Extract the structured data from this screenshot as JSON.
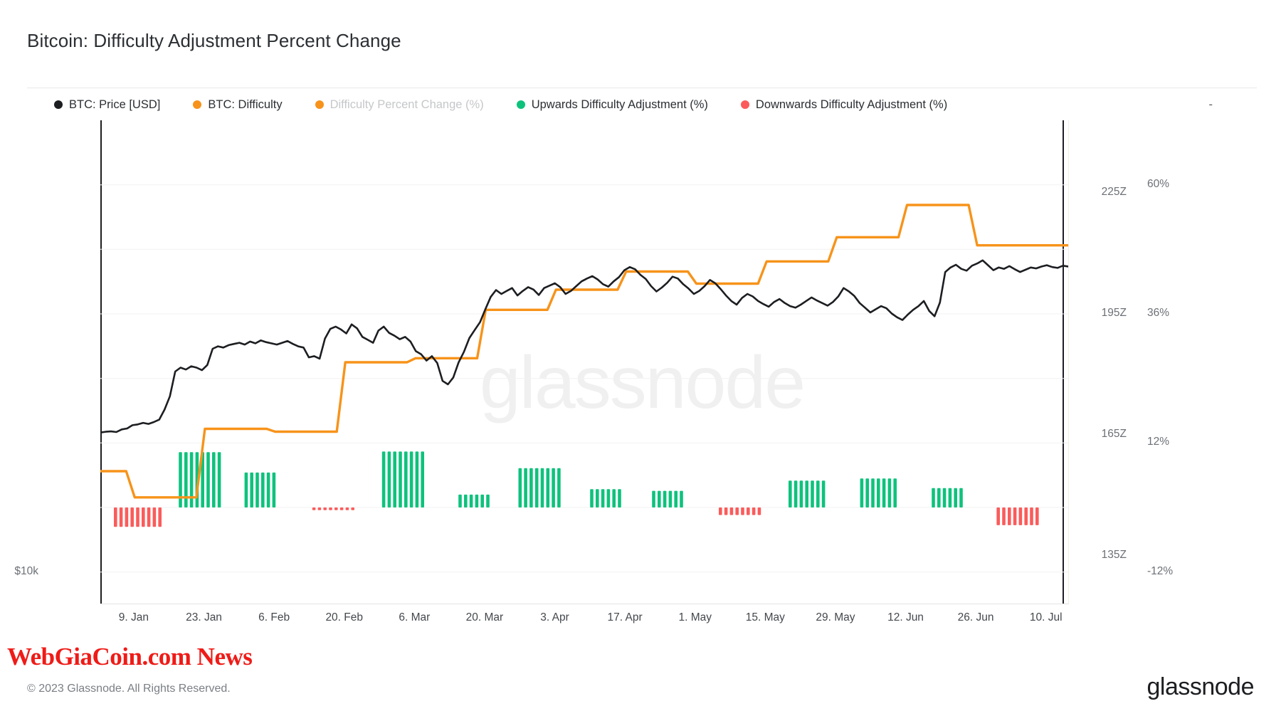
{
  "header": {
    "title": "Bitcoin: Difficulty Adjustment Percent Change"
  },
  "legend": {
    "items": [
      {
        "label": "BTC: Price [USD]",
        "color": "#1c1e21",
        "disabled": false,
        "icon": "legend-dot-icon"
      },
      {
        "label": "BTC: Difficulty",
        "color": "#f7931a",
        "disabled": false,
        "icon": "legend-dot-icon"
      },
      {
        "label": "Difficulty Percent Change (%)",
        "color": "#f7931a",
        "disabled": true,
        "icon": "legend-dot-icon"
      },
      {
        "label": "Upwards Difficulty Adjustment (%)",
        "color": "#0ec27c",
        "disabled": false,
        "icon": "legend-dot-icon"
      },
      {
        "label": "Downwards Difficulty Adjustment (%)",
        "color": "#fb5b5b",
        "disabled": false,
        "icon": "legend-dot-icon"
      }
    ],
    "trailing": "-"
  },
  "footer": {
    "banner": "WebGiaCoin.com News",
    "copyright": "© 2023 Glassnode. All Rights Reserved.",
    "brand": "glassnode",
    "watermark": "glassnode"
  },
  "chart_data": {
    "type": "line",
    "title": "Bitcoin: Difficulty Adjustment Percent Change",
    "xlabel": "",
    "ylabel": "",
    "grid": true,
    "legend_position": "top-left",
    "axes": {
      "left": {
        "name": "BTC: Price [USD]",
        "color": "#1c1e21",
        "scale": "log",
        "ticks": [
          "$10k"
        ],
        "tick_values": [
          10000
        ]
      },
      "right_inner": {
        "name": "BTC: Difficulty",
        "color": "#f7931a",
        "ticks": [
          "225Z",
          "195Z",
          "165Z",
          "135Z"
        ],
        "tick_values": [
          225,
          195,
          165,
          135
        ],
        "unit": "Z"
      },
      "right_outer": {
        "name": "Difficulty Adjustment (%)",
        "ticks": [
          "60%",
          "36%",
          "12%",
          "-12%"
        ],
        "tick_values": [
          60,
          36,
          12,
          -12
        ],
        "unit": "%"
      },
      "x": {
        "ticks": [
          "9. Jan",
          "23. Jan",
          "6. Feb",
          "20. Feb",
          "6. Mar",
          "20. Mar",
          "3. Apr",
          "17. Apr",
          "1. May",
          "15. May",
          "29. May",
          "12. Jun",
          "26. Jun",
          "10. Jul"
        ],
        "range": [
          "2023-01-02",
          "2023-07-14"
        ]
      }
    },
    "series": [
      {
        "name": "BTC: Price [USD]",
        "type": "line",
        "color": "#1c1e21",
        "axis": "left",
        "values": [
          16650,
          16700,
          16720,
          16680,
          16840,
          16900,
          17100,
          17150,
          17250,
          17180,
          17300,
          17450,
          18100,
          19000,
          20800,
          21100,
          20950,
          21200,
          21100,
          20900,
          21300,
          22600,
          22800,
          22700,
          22900,
          23000,
          23100,
          22950,
          23200,
          23050,
          23300,
          23150,
          23050,
          22950,
          23100,
          23250,
          23000,
          22800,
          22700,
          21900,
          22000,
          21800,
          23450,
          24300,
          24500,
          24250,
          23900,
          24700,
          24350,
          23600,
          23350,
          23100,
          24150,
          24500,
          23950,
          23700,
          23400,
          23600,
          23200,
          22400,
          22150,
          21650,
          22000,
          21450,
          20100,
          19850,
          20350,
          21500,
          22350,
          23500,
          24200,
          24900,
          26100,
          27300,
          28000,
          27600,
          27900,
          28200,
          27450,
          27900,
          28300,
          28050,
          27500,
          28200,
          28450,
          28700,
          28300,
          27600,
          27900,
          28400,
          28900,
          29200,
          29450,
          29100,
          28600,
          28350,
          28900,
          29350,
          30100,
          30450,
          30200,
          29600,
          29150,
          28400,
          27850,
          28250,
          28750,
          29400,
          29200,
          28600,
          28150,
          27600,
          27900,
          28400,
          29050,
          28700,
          28100,
          27450,
          26900,
          26550,
          27200,
          27600,
          27350,
          26900,
          26600,
          26350,
          26800,
          27100,
          26700,
          26400,
          26250,
          26550,
          26900,
          27250,
          26950,
          26700,
          26450,
          26800,
          27350,
          28200,
          27850,
          27400,
          26700,
          26250,
          25800,
          26100,
          26400,
          26200,
          25700,
          25350,
          25100,
          25600,
          26050,
          26400,
          26900,
          25950,
          25450,
          26750,
          29900,
          30400,
          30700,
          30250,
          30050,
          30600,
          30850,
          31200,
          30650,
          30100,
          30400,
          30250,
          30550,
          30200,
          29900,
          30150,
          30400,
          30300,
          30500,
          30650,
          30450,
          30350,
          30600,
          30500
        ]
      },
      {
        "name": "BTC: Difficulty",
        "type": "step",
        "color": "#f7931a",
        "axis": "right_inner",
        "unit": "Z",
        "steps": [
          {
            "x": "2023-01-02",
            "value": 156.0
          },
          {
            "x": "2023-01-08",
            "value": 149.5
          },
          {
            "x": "2023-01-22",
            "value": 166.5
          },
          {
            "x": "2023-02-05",
            "value": 165.8
          },
          {
            "x": "2023-02-19",
            "value": 183.0
          },
          {
            "x": "2023-03-05",
            "value": 184.0
          },
          {
            "x": "2023-03-19",
            "value": 196.0
          },
          {
            "x": "2023-04-02",
            "value": 201.0
          },
          {
            "x": "2023-04-16",
            "value": 205.5
          },
          {
            "x": "2023-04-30",
            "value": 202.5
          },
          {
            "x": "2023-05-14",
            "value": 208.0
          },
          {
            "x": "2023-05-28",
            "value": 214.0
          },
          {
            "x": "2023-06-11",
            "value": 222.0
          },
          {
            "x": "2023-06-25",
            "value": 212.0
          },
          {
            "x": "2023-07-14",
            "value": 212.0
          }
        ]
      },
      {
        "name": "Upwards Difficulty Adjustment (%)",
        "type": "bar",
        "color": "#0ec27c",
        "axis": "right_outer",
        "clusters": [
          {
            "start_pct": 8.1,
            "count": 8,
            "value": 10.3
          },
          {
            "start_pct": 14.9,
            "count": 6,
            "value": 6.5
          },
          {
            "start_pct": 29.1,
            "count": 8,
            "value": 10.4
          },
          {
            "start_pct": 37.0,
            "count": 6,
            "value": 2.4
          },
          {
            "start_pct": 43.2,
            "count": 8,
            "value": 7.3
          },
          {
            "start_pct": 50.6,
            "count": 6,
            "value": 3.4
          },
          {
            "start_pct": 57.0,
            "count": 6,
            "value": 3.1
          },
          {
            "start_pct": 71.1,
            "count": 7,
            "value": 5.0
          },
          {
            "start_pct": 78.5,
            "count": 7,
            "value": 5.4
          },
          {
            "start_pct": 85.9,
            "count": 6,
            "value": 3.6
          }
        ]
      },
      {
        "name": "Downwards Difficulty Adjustment (%)",
        "type": "bar",
        "color": "#fb5b5b",
        "axis": "right_outer",
        "clusters": [
          {
            "start_pct": 1.4,
            "count": 9,
            "value": -3.6
          },
          {
            "start_pct": 21.9,
            "count": 8,
            "value": -0.5
          },
          {
            "start_pct": 63.9,
            "count": 8,
            "value": -1.4
          },
          {
            "start_pct": 92.6,
            "count": 8,
            "value": -3.3
          }
        ]
      }
    ]
  }
}
